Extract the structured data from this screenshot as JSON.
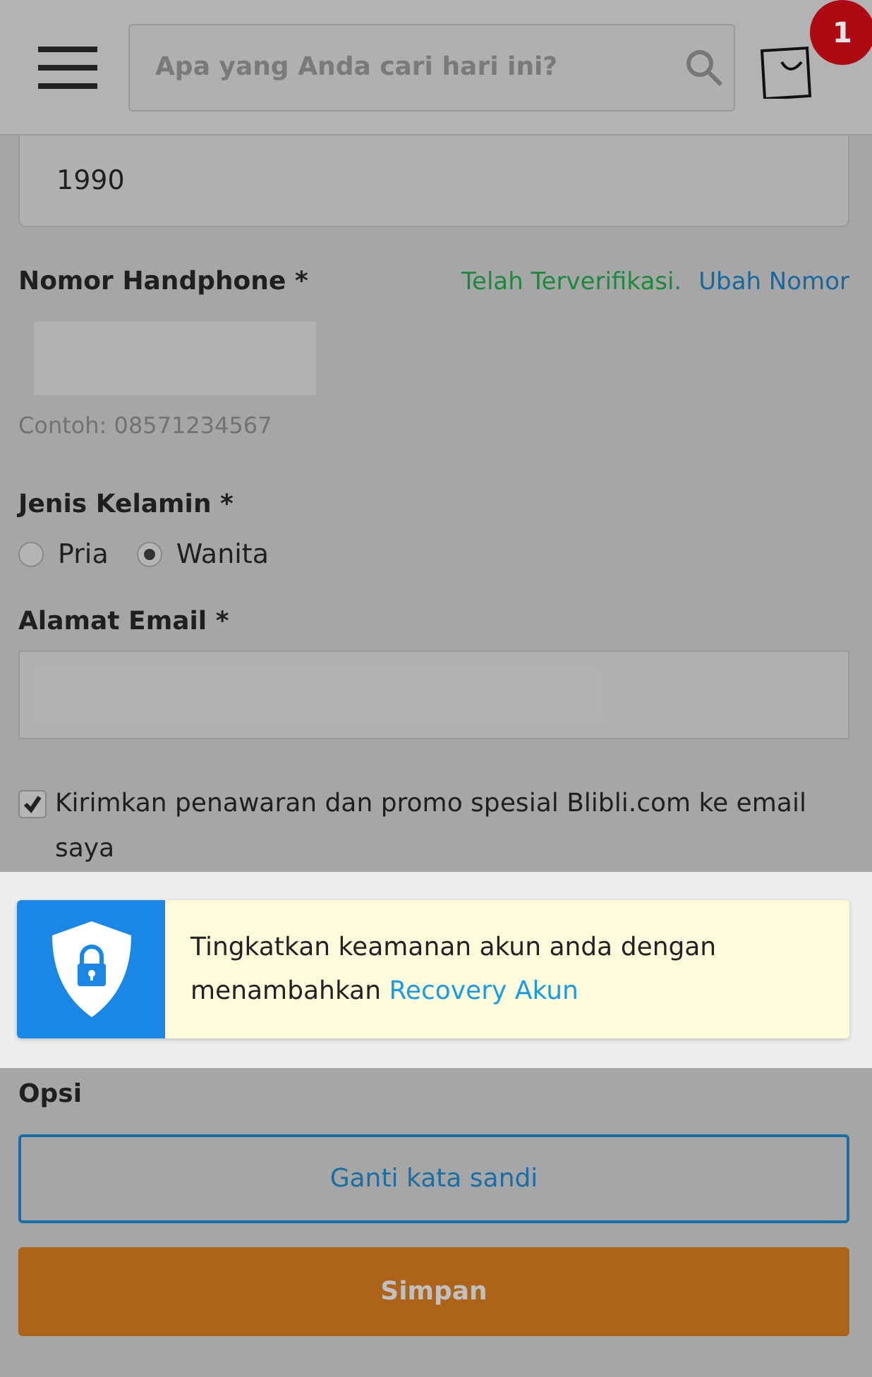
{
  "header": {
    "search": {
      "placeholder": "Apa yang Anda cari hari ini?"
    },
    "cart_count": "1"
  },
  "birth_year": {
    "value": "1990"
  },
  "phone": {
    "label": "Nomor Handphone *",
    "status": "Telah Terverifikasi.",
    "change_link": "Ubah Nomor",
    "hint": "Contoh: 08571234567"
  },
  "gender": {
    "label": "Jenis Kelamin *",
    "options": [
      {
        "label": "Pria",
        "selected": false
      },
      {
        "label": "Wanita",
        "selected": true
      }
    ]
  },
  "email": {
    "label": "Alamat Email *"
  },
  "newsletter": {
    "label": "Kirimkan penawaran dan promo spesial Blibli.com ke email saya",
    "checked": true
  },
  "recovery_banner": {
    "text": "Tingkatkan keamanan akun anda dengan menambahkan",
    "link": "Recovery Akun"
  },
  "options": {
    "title": "Opsi",
    "buttons": [
      {
        "label": "Ganti kata sandi",
        "kind": "outline"
      },
      {
        "label": "Simpan",
        "kind": "primary"
      }
    ]
  }
}
